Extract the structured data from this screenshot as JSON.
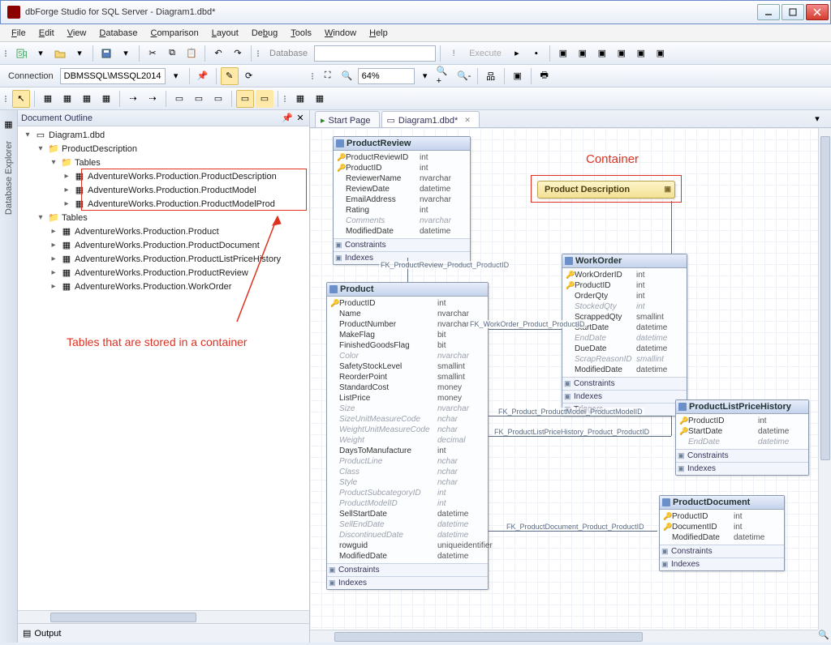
{
  "window": {
    "title": "dbForge Studio for SQL Server - Diagram1.dbd*"
  },
  "menu": [
    "File",
    "Edit",
    "View",
    "Database",
    "Comparison",
    "Layout",
    "Debug",
    "Tools",
    "Window",
    "Help"
  ],
  "toolbar1": {
    "connection_label": "Connection",
    "connection_value": "DBMSSQL\\MSSQL2014",
    "database_label": "Database",
    "execute_label": "Execute",
    "zoom_value": "64%"
  },
  "leftTabs": [
    "Database Explorer"
  ],
  "outline": {
    "title": "Document Outline",
    "root": "Diagram1.dbd",
    "group1": "ProductDescription",
    "tables_label": "Tables",
    "container_tables": [
      "AdventureWorks.Production.ProductDescription",
      "AdventureWorks.Production.ProductModel",
      "AdventureWorks.Production.ProductModelProd"
    ],
    "loose_tables": [
      "AdventureWorks.Production.Product",
      "AdventureWorks.Production.ProductDocument",
      "AdventureWorks.Production.ProductListPriceHistory",
      "AdventureWorks.Production.ProductReview",
      "AdventureWorks.Production.WorkOrder"
    ],
    "output_label": "Output"
  },
  "annotations": {
    "container": "Container",
    "tables_in_container": "Tables that are stored in a container"
  },
  "tabs": [
    {
      "label": "Start Page",
      "active": false,
      "icon": "play"
    },
    {
      "label": "Diagram1.dbd*",
      "active": true,
      "icon": "doc"
    }
  ],
  "entities": {
    "ProductReview": {
      "title": "ProductReview",
      "cols": [
        {
          "k": "🔑",
          "n": "ProductReviewID",
          "t": "int"
        },
        {
          "k": "🔑",
          "n": "ProductID",
          "t": "int"
        },
        {
          "k": "",
          "n": "ReviewerName",
          "t": "nvarchar"
        },
        {
          "k": "",
          "n": "ReviewDate",
          "t": "datetime"
        },
        {
          "k": "",
          "n": "EmailAddress",
          "t": "nvarchar"
        },
        {
          "k": "",
          "n": "Rating",
          "t": "int"
        },
        {
          "k": "",
          "n": "Comments",
          "t": "nvarchar",
          "null": true
        },
        {
          "k": "",
          "n": "ModifiedDate",
          "t": "datetime"
        }
      ],
      "sects": [
        "Constraints",
        "Indexes"
      ]
    },
    "WorkOrder": {
      "title": "WorkOrder",
      "cols": [
        {
          "k": "🔑",
          "n": "WorkOrderID",
          "t": "int"
        },
        {
          "k": "🔑",
          "n": "ProductID",
          "t": "int"
        },
        {
          "k": "",
          "n": "OrderQty",
          "t": "int"
        },
        {
          "k": "",
          "n": "StockedQty",
          "t": "int",
          "null": true
        },
        {
          "k": "",
          "n": "ScrappedQty",
          "t": "smallint"
        },
        {
          "k": "",
          "n": "StartDate",
          "t": "datetime"
        },
        {
          "k": "",
          "n": "EndDate",
          "t": "datetime",
          "null": true
        },
        {
          "k": "",
          "n": "DueDate",
          "t": "datetime"
        },
        {
          "k": "",
          "n": "ScrapReasonID",
          "t": "smallint",
          "null": true
        },
        {
          "k": "",
          "n": "ModifiedDate",
          "t": "datetime"
        }
      ],
      "sects": [
        "Constraints",
        "Indexes",
        "Triggers"
      ]
    },
    "Product": {
      "title": "Product",
      "cols": [
        {
          "k": "🔑",
          "n": "ProductID",
          "t": "int"
        },
        {
          "k": "",
          "n": "Name",
          "t": "nvarchar"
        },
        {
          "k": "",
          "n": "ProductNumber",
          "t": "nvarchar"
        },
        {
          "k": "",
          "n": "MakeFlag",
          "t": "bit"
        },
        {
          "k": "",
          "n": "FinishedGoodsFlag",
          "t": "bit"
        },
        {
          "k": "",
          "n": "Color",
          "t": "nvarchar",
          "null": true
        },
        {
          "k": "",
          "n": "SafetyStockLevel",
          "t": "smallint"
        },
        {
          "k": "",
          "n": "ReorderPoint",
          "t": "smallint"
        },
        {
          "k": "",
          "n": "StandardCost",
          "t": "money"
        },
        {
          "k": "",
          "n": "ListPrice",
          "t": "money"
        },
        {
          "k": "",
          "n": "Size",
          "t": "nvarchar",
          "null": true
        },
        {
          "k": "",
          "n": "SizeUnitMeasureCode",
          "t": "nchar",
          "null": true
        },
        {
          "k": "",
          "n": "WeightUnitMeasureCode",
          "t": "nchar",
          "null": true
        },
        {
          "k": "",
          "n": "Weight",
          "t": "decimal",
          "null": true
        },
        {
          "k": "",
          "n": "DaysToManufacture",
          "t": "int"
        },
        {
          "k": "",
          "n": "ProductLine",
          "t": "nchar",
          "null": true
        },
        {
          "k": "",
          "n": "Class",
          "t": "nchar",
          "null": true
        },
        {
          "k": "",
          "n": "Style",
          "t": "nchar",
          "null": true
        },
        {
          "k": "",
          "n": "ProductSubcategoryID",
          "t": "int",
          "null": true
        },
        {
          "k": "",
          "n": "ProductModelID",
          "t": "int",
          "null": true
        },
        {
          "k": "",
          "n": "SellStartDate",
          "t": "datetime"
        },
        {
          "k": "",
          "n": "SellEndDate",
          "t": "datetime",
          "null": true
        },
        {
          "k": "",
          "n": "DiscontinuedDate",
          "t": "datetime",
          "null": true
        },
        {
          "k": "",
          "n": "rowguid",
          "t": "uniqueidentifier"
        },
        {
          "k": "",
          "n": "ModifiedDate",
          "t": "datetime"
        }
      ],
      "sects": [
        "Constraints",
        "Indexes"
      ]
    },
    "ProductListPriceHistory": {
      "title": "ProductListPriceHistory",
      "cols": [
        {
          "k": "🔑",
          "n": "ProductID",
          "t": "int"
        },
        {
          "k": "🔑",
          "n": "StartDate",
          "t": "datetime"
        },
        {
          "k": "",
          "n": "EndDate",
          "t": "datetime",
          "null": true
        }
      ],
      "sects": [
        "Constraints",
        "Indexes"
      ]
    },
    "ProductDocument": {
      "title": "ProductDocument",
      "cols": [
        {
          "k": "🔑",
          "n": "ProductID",
          "t": "int"
        },
        {
          "k": "🔑",
          "n": "DocumentID",
          "t": "int"
        },
        {
          "k": "",
          "n": "ModifiedDate",
          "t": "datetime"
        }
      ],
      "sects": [
        "Constraints",
        "Indexes"
      ]
    }
  },
  "container_box": {
    "label": "Product Description"
  },
  "relations": [
    "FK_ProductReview_Product_ProductID",
    "FK_WorkOrder_Product_ProductID",
    "FK_Product_ProductModel_ProductModelID",
    "FK_ProductListPriceHistory_Product_ProductID",
    "FK_ProductDocument_Product_ProductID"
  ]
}
